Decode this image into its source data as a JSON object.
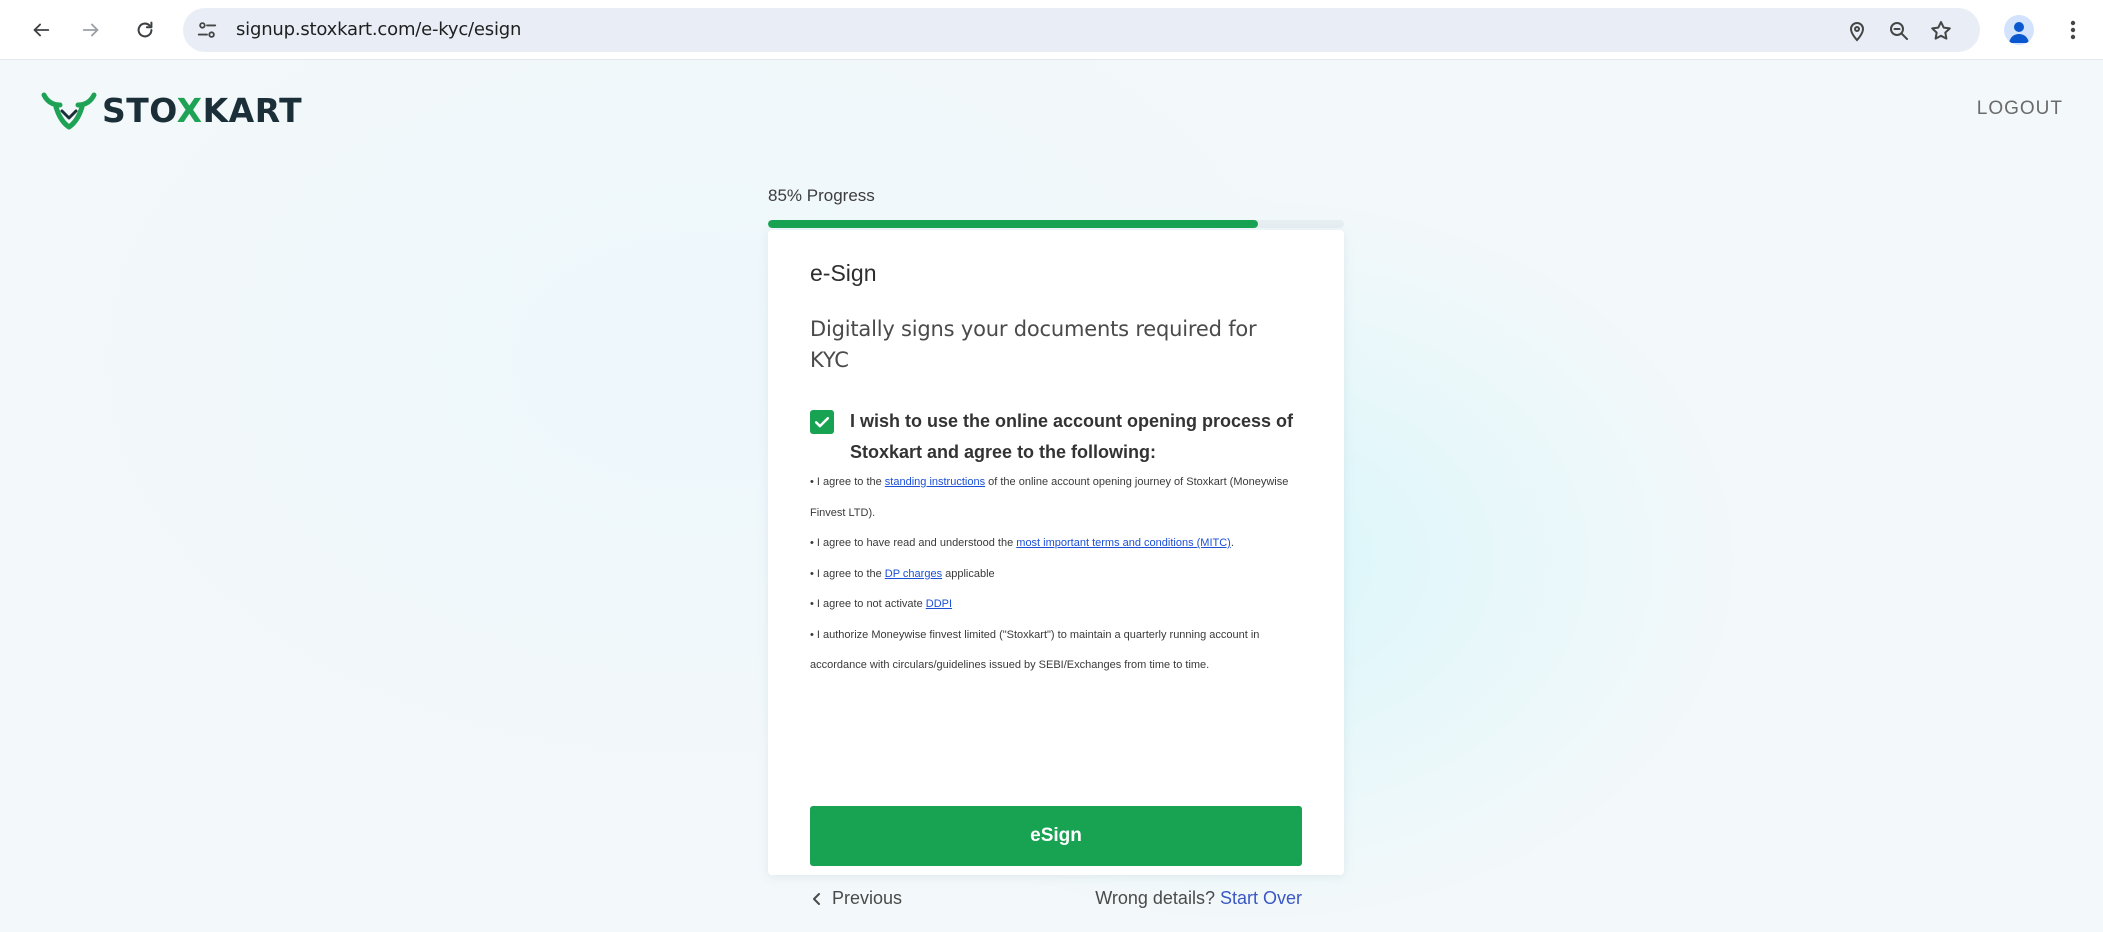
{
  "browser": {
    "url": "signup.stoxkart.com/e-kyc/esign"
  },
  "header": {
    "brand_pre": "STO",
    "brand_x": "X",
    "brand_post": "KART",
    "logout_label": "LOGOUT"
  },
  "progress": {
    "label": "85% Progress",
    "percent": 85
  },
  "card": {
    "title": "e-Sign",
    "subtitle": "Digitally signs your documents required for KYC",
    "consent_checked": true,
    "consent_text": "I wish to use the online account opening process of Stoxkart and agree to the following:",
    "terms": [
      {
        "pre": "• I agree to the ",
        "link": "standing instructions",
        "post": " of the online account opening journey of Stoxkart (Moneywise Finvest LTD)."
      },
      {
        "pre": "• I agree to have read and understood the ",
        "link": "most important terms and conditions (MITC)",
        "post": "."
      },
      {
        "pre": "• I agree to the ",
        "link": "DP charges",
        "post": " applicable"
      },
      {
        "pre": "• I agree to not activate ",
        "link": "DDPI",
        "post": ""
      },
      {
        "pre": "• I authorize Moneywise finvest limited (\"Stoxkart\") to maintain a quarterly running account in accordance with circulars/guidelines issued by SEBI/Exchanges from time to time.",
        "link": "",
        "post": ""
      }
    ],
    "esign_label": "eSign",
    "previous_label": "Previous",
    "wrong_details_label": "Wrong details?",
    "start_over_label": "Start Over"
  },
  "colors": {
    "accent": "#17a352",
    "link": "#1a4fd6"
  }
}
